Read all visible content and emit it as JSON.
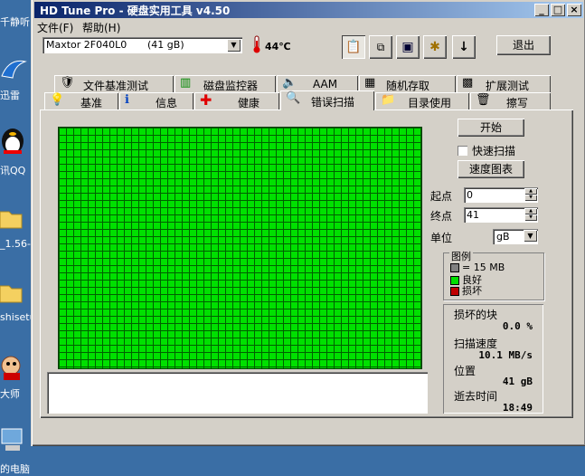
{
  "desktop": {
    "labels": [
      "千静听",
      "迅雷",
      "讯QQ",
      "_1.56-",
      "shisetu",
      "大师",
      "的电脑"
    ]
  },
  "window": {
    "title": "HD Tune Pro - 硬盘实用工具 v4.50",
    "controls": {
      "minimize": "_",
      "maximize": "□",
      "close": "×"
    }
  },
  "menu": {
    "file": "文件(F)",
    "help": "帮助(H)"
  },
  "drive": {
    "name": "Maxtor 2F040L0",
    "capacity": "(41 gB)"
  },
  "temperature": "44℃",
  "toolbar": {
    "exit_label": "退出"
  },
  "tabs_top": [
    {
      "label": "文件基准测试",
      "icon": "file-benchmark-icon"
    },
    {
      "label": "磁盘监控器",
      "icon": "disk-monitor-icon"
    },
    {
      "label": "AAM",
      "icon": "speaker-icon"
    },
    {
      "label": "随机存取",
      "icon": "random-access-icon"
    },
    {
      "label": "扩展测试",
      "icon": "extended-test-icon"
    }
  ],
  "tabs_bottom": [
    {
      "label": "基准",
      "icon": "benchmark-icon"
    },
    {
      "label": "信息",
      "icon": "info-icon"
    },
    {
      "label": "健康",
      "icon": "health-icon"
    },
    {
      "label": "错误扫描",
      "icon": "magnifier-icon"
    },
    {
      "label": "目录使用",
      "icon": "folder-icon"
    },
    {
      "label": "擦写",
      "icon": "erase-icon"
    }
  ],
  "controls": {
    "start_label": "开始",
    "quick_scan_label": "快速扫描",
    "quick_scan_checked": false,
    "speed_map_label": "速度图表",
    "start_point_label": "起点",
    "start_point_value": "0",
    "end_point_label": "终点",
    "end_point_value": "41",
    "unit_label": "单位",
    "unit_value": "gB"
  },
  "legend": {
    "title": "图例",
    "items": [
      {
        "label": "= 15 MB",
        "color": "#808080"
      },
      {
        "label": "良好",
        "color": "#00e000"
      },
      {
        "label": "损坏",
        "color": "#c00000"
      }
    ]
  },
  "stats": {
    "damaged_label": "损坏的块",
    "damaged_value": "0.0 %",
    "speed_label": "扫描速度",
    "speed_value": "10.1 MB/s",
    "position_label": "位置",
    "position_value": "41 gB",
    "elapsed_label": "逝去时间",
    "elapsed_value": "18:49"
  },
  "colors": {
    "good_block": "#00e000",
    "titlebar": "#0a246a"
  }
}
